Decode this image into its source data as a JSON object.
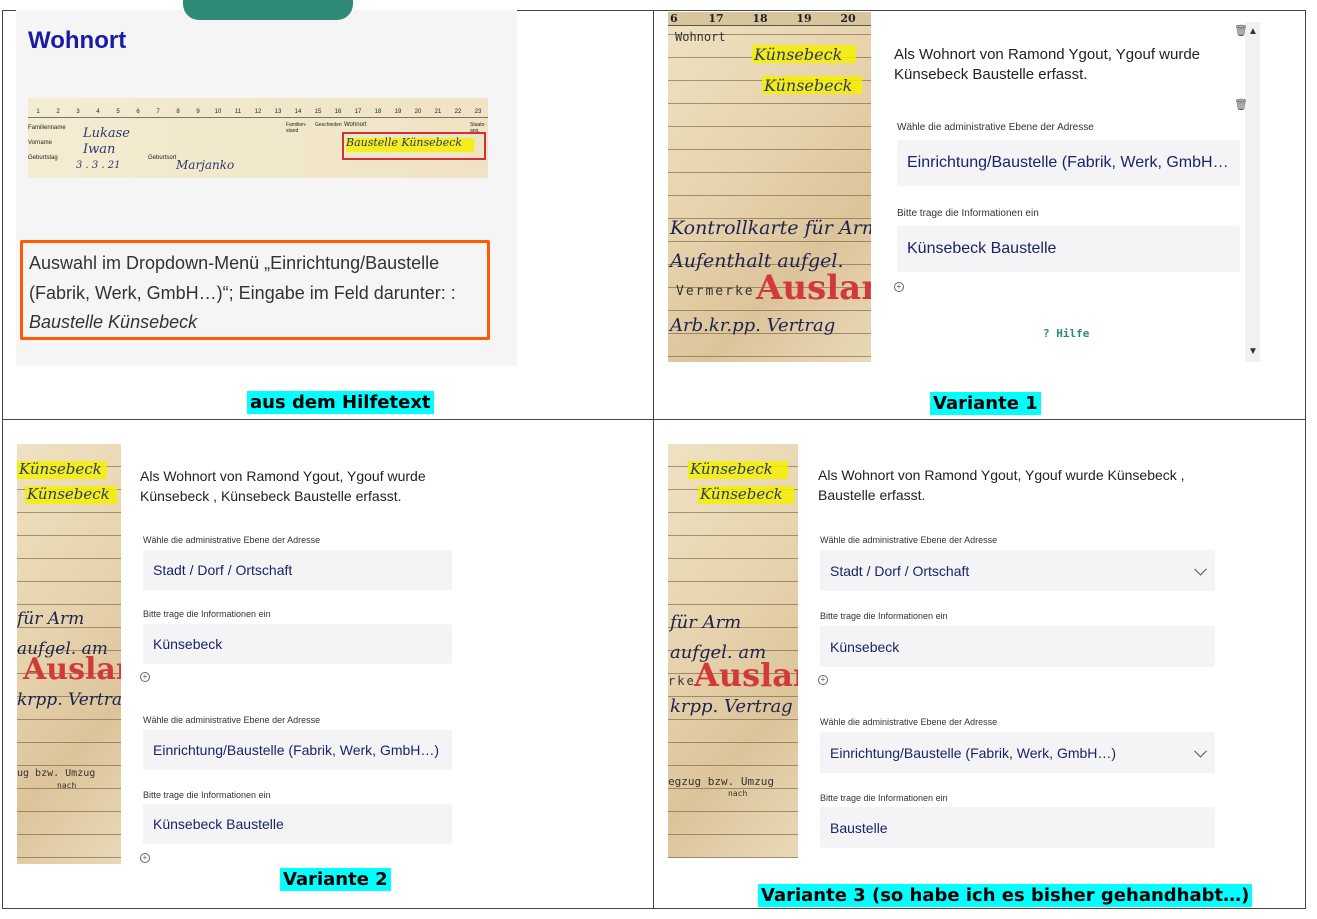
{
  "quadrant_help": {
    "title": "Wohnort",
    "card": {
      "col_numbers": [
        "1",
        "2",
        "3",
        "4",
        "5",
        "6",
        "7",
        "8",
        "9",
        "10",
        "11",
        "12",
        "13",
        "14",
        "15",
        "16",
        "17",
        "18",
        "19",
        "20",
        "21",
        "22",
        "23"
      ],
      "row_labels": [
        "Familienname",
        "Vorname",
        "Geburtstag",
        "Geburtsort"
      ],
      "col_labels": [
        "Familien-stand",
        "Geschieden",
        "Wohnort",
        "Staats-ang."
      ],
      "handwritten": [
        "Lukase",
        "Iwan",
        "3 . 3 . 21",
        "Marjanko",
        "Baustelle Künsebeck"
      ]
    },
    "note_line1": "Auswahl im Dropdown-Menü „Einrichtung/Baustelle",
    "note_line2": "(Fabrik, Werk, GmbH…)“; Eingabe im Feld darunter: :",
    "note_line3": "Baustelle Künsebeck",
    "caption": "aus dem Hilfetext",
    "accent_color": "#ff5a00",
    "title_color": "#1a1aa6"
  },
  "variant1": {
    "card_header_numbers": [
      "6",
      "17",
      "18",
      "19",
      "20"
    ],
    "card_label": "Wohnort",
    "card_vermerke": "Vermerke",
    "card_stamp": "Ausland",
    "card_scribbles": [
      "Künsebeck",
      "Künsebeck",
      "Kontrollkarte für Arm",
      "Aufenthalt aufgel.",
      "Arb.kr.pp. Vertrag"
    ],
    "message": "Als Wohnort von Ramond Ygout, Ygouf wurde Künsebeck Baustelle erfasst.",
    "level_label": "Wähle die administrative Ebene der Adresse",
    "level_value": "Einrichtung/Baustelle (Fabrik, Werk, GmbH…",
    "info_label": "Bitte trage die Informationen ein",
    "info_value": "Künsebeck Baustelle",
    "help_label": "? Hilfe",
    "caption": "Variante 1"
  },
  "variant2": {
    "card_stamp": "Auslan",
    "card_scribbles": [
      "Künsebeck",
      "Künsebeck",
      "für Arm",
      "aufgel. am",
      "krpp. Vertrag"
    ],
    "card_footer": "ug bzw. Umzug",
    "card_footer2": "nach",
    "message": "Als Wohnort von Ramond Ygout, Ygouf wurde Künsebeck , Künsebeck Baustelle erfasst.",
    "level_label_1": "Wähle die administrative Ebene der Adresse",
    "level_value_1": "Stadt / Dorf / Ortschaft",
    "info_label_1": "Bitte trage die Informationen ein",
    "info_value_1": "Künsebeck",
    "level_label_2": "Wähle die administrative Ebene der Adresse",
    "level_value_2": "Einrichtung/Baustelle (Fabrik, Werk, GmbH…)",
    "info_label_2": "Bitte trage die Informationen ein",
    "info_value_2": "Künsebeck Baustelle",
    "caption": "Variante 2"
  },
  "variant3": {
    "card_stamp": "Auslan",
    "card_vermerke": "rke",
    "card_scribbles": [
      "Künsebeck",
      "Künsebeck",
      "für Arm",
      "aufgel. am",
      "krpp. Vertrag"
    ],
    "card_footer": "egzug bzw. Umzug",
    "card_footer2": "nach",
    "message_line1": "Als Wohnort von Ramond Ygout, Ygouf wurde Künsebeck ,",
    "message_line2": "Baustelle erfasst.",
    "level_label_1": "Wähle die administrative Ebene der Adresse",
    "level_value_1": "Stadt / Dorf / Ortschaft",
    "info_label_1": "Bitte trage die Informationen ein",
    "info_value_1": "Künsebeck",
    "level_label_2": "Wähle die administrative Ebene der Adresse",
    "level_value_2": "Einrichtung/Baustelle (Fabrik, Werk, GmbH…)",
    "info_label_2": "Bitte trage die Informationen ein",
    "info_value_2": "Baustelle",
    "caption": "Variante 3  (so habe ich es bisher gehandhabt…)"
  }
}
